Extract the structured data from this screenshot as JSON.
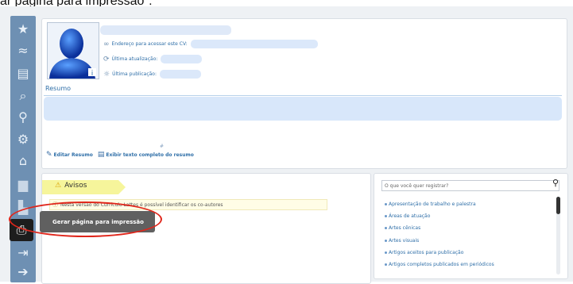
{
  "caption": "ar página para impressão\".",
  "toolbar": {
    "icons": [
      "star-icon",
      "wave-icon",
      "contact-card-icon",
      "search-document-icon",
      "search-icon",
      "puzzle-head-icon",
      "institution-icon",
      "printer-icon",
      "file-list-icon",
      "print-page-icon",
      "export-icon",
      "logout-icon"
    ],
    "tooltip": "Gerar página para impressão"
  },
  "profile": {
    "cv_address_label": "Endereço para acessar este CV:",
    "last_update_label": "Última atualização:",
    "last_publication_label": "Última publicação:",
    "resumo_label": "Resumo",
    "edit_resumo": "Editar Resumo",
    "full_text": "Exibir texto completo do resumo"
  },
  "avisos": {
    "title": "Avisos",
    "notice": "Nesta versão do Currículo Lattes é possível identificar os co-autores"
  },
  "register": {
    "placeholder": "O que você quer registrar?",
    "items": [
      "Apresentação de trabalho e palestra",
      "Áreas de atuação",
      "Artes cênicas",
      "Artes visuais",
      "Artigos aceitos para publicação",
      "Artigos completos publicados em periódicos"
    ]
  },
  "colors": {
    "toolbar": "#6e90b3",
    "tooltip": "#606060",
    "highlight_oval": "#e0261b",
    "link": "#2f6fa8",
    "avisos_tab": "#f6f59b"
  }
}
